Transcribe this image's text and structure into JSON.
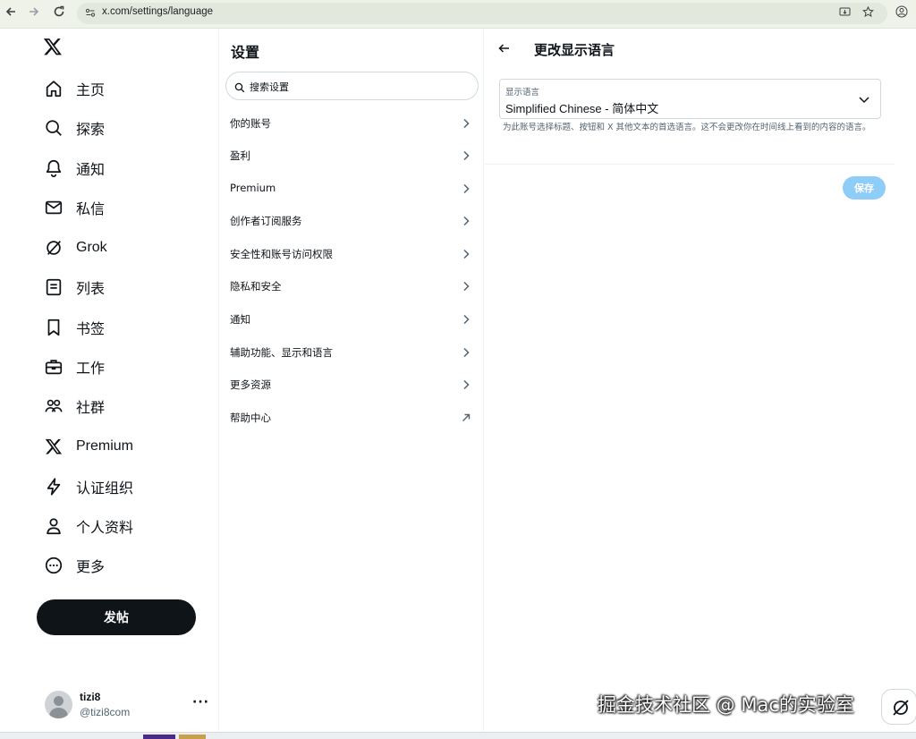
{
  "browser": {
    "url": "x.com/settings/language",
    "back_icon": "arrow-left-icon",
    "forward_icon": "arrow-right-icon",
    "reload_icon": "reload-icon"
  },
  "leftnav": {
    "logo": "x-logo",
    "items": [
      {
        "label": "主页",
        "icon": "home-icon"
      },
      {
        "label": "探索",
        "icon": "search-icon"
      },
      {
        "label": "通知",
        "icon": "bell-icon"
      },
      {
        "label": "私信",
        "icon": "mail-icon"
      },
      {
        "label": "Grok",
        "icon": "grok-icon"
      },
      {
        "label": "列表",
        "icon": "list-icon"
      },
      {
        "label": "书签",
        "icon": "bookmark-icon"
      },
      {
        "label": "工作",
        "icon": "briefcase-icon"
      },
      {
        "label": "社群",
        "icon": "community-icon"
      },
      {
        "label": "Premium",
        "icon": "x-logo-icon"
      },
      {
        "label": "认证组织",
        "icon": "lightning-icon"
      },
      {
        "label": "个人资料",
        "icon": "person-icon"
      },
      {
        "label": "更多",
        "icon": "more-circle-icon"
      }
    ],
    "post_label": "发帖",
    "profile": {
      "name": "tizi8",
      "handle": "@tizi8com",
      "more": "···"
    }
  },
  "settings": {
    "title": "设置",
    "search_placeholder": "搜索设置",
    "items": [
      {
        "label": "你的账号",
        "icon": "chevron-right-icon"
      },
      {
        "label": "盈利",
        "icon": "chevron-right-icon"
      },
      {
        "label": "Premium",
        "icon": "chevron-right-icon"
      },
      {
        "label": "创作者订阅服务",
        "icon": "chevron-right-icon"
      },
      {
        "label": "安全性和账号访问权限",
        "icon": "chevron-right-icon"
      },
      {
        "label": "隐私和安全",
        "icon": "chevron-right-icon"
      },
      {
        "label": "通知",
        "icon": "chevron-right-icon"
      },
      {
        "label": "辅助功能、显示和语言",
        "icon": "chevron-right-icon"
      },
      {
        "label": "更多资源",
        "icon": "chevron-right-icon"
      },
      {
        "label": "帮助中心",
        "icon": "external-arrow-icon"
      }
    ]
  },
  "language": {
    "title": "更改显示语言",
    "select_label": "显示语言",
    "select_value": "Simplified Chinese - 简体中文",
    "help_text": "为此账号选择标题、按钮和 X 其他文本的首选语言。这不会更改你在时间线上看到的内容的语言。",
    "save_label": "保存"
  },
  "watermark": "掘金技术社区 @ Mac的实验室",
  "colors": {
    "text": "#0f1419",
    "muted": "#536471",
    "border": "#cfd9de",
    "save_disabled": "#8ecdf8",
    "post_button": "#0f1419"
  }
}
